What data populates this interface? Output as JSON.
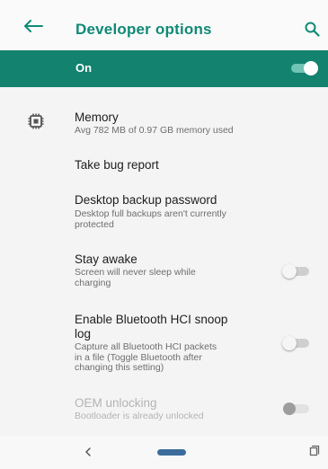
{
  "appbar": {
    "title": "Developer options",
    "back_icon": "arrow-left-icon",
    "search_icon": "search-icon",
    "accent_color": "#0f8a76"
  },
  "master_switch": {
    "label": "On",
    "enabled": true,
    "background_color": "#13826f"
  },
  "settings": [
    {
      "title": "Memory",
      "summary": "Avg 782 MB of 0.97 GB memory used",
      "icon": "memory-chip-icon"
    },
    {
      "title": "Take bug report"
    },
    {
      "title": "Desktop backup password",
      "summary_lines": [
        "Desktop full backups aren't currently",
        "protected"
      ]
    },
    {
      "title": "Stay awake",
      "summary_lines": [
        "Screen will never sleep while",
        "charging"
      ],
      "toggle": false
    },
    {
      "title_lines": [
        "Enable Bluetooth HCI snoop",
        "log"
      ],
      "summary_lines": [
        "Capture all Bluetooth HCI packets",
        "in a file (Toggle Bluetooth after",
        "changing this setting)"
      ],
      "toggle": false
    },
    {
      "title": "OEM unlocking",
      "summary": "Bootloader is already unlocked",
      "toggle": false,
      "disabled": true
    }
  ],
  "navbar": {
    "back": "nav-back-icon",
    "home": "nav-home-icon",
    "recents": "nav-recents-icon"
  }
}
